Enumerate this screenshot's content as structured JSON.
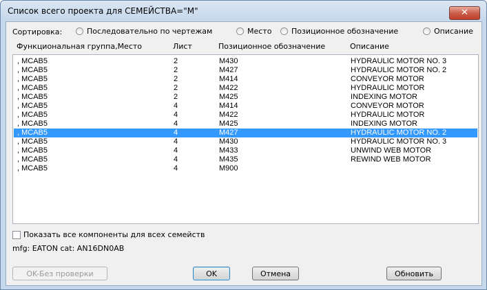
{
  "window": {
    "title": "Список всего проекта для СЕМЕЙСТВА=\"M\"",
    "close_label": "✕"
  },
  "sort": {
    "label": "Сортировка:",
    "options": [
      "Последовательно по чертежам",
      "Место",
      "Позиционное обозначение",
      "Описание"
    ]
  },
  "columns": [
    "Функциональная группа,Место",
    "Лист",
    "Позиционное обозначение",
    "Описание"
  ],
  "rows": [
    {
      "loc": ", MCAB5",
      "sheet": "2",
      "tag": "M430",
      "desc": "HYDRAULIC MOTOR NO. 3"
    },
    {
      "loc": ", MCAB5",
      "sheet": "2",
      "tag": "M427",
      "desc": "HYDRAULIC MOTOR NO. 2"
    },
    {
      "loc": ", MCAB5",
      "sheet": "2",
      "tag": "M414",
      "desc": "CONVEYOR MOTOR"
    },
    {
      "loc": ", MCAB5",
      "sheet": "2",
      "tag": "M422",
      "desc": "HYDRAULIC MOTOR"
    },
    {
      "loc": ", MCAB5",
      "sheet": "2",
      "tag": "M425",
      "desc": "INDEXING MOTOR"
    },
    {
      "loc": ", MCAB5",
      "sheet": "4",
      "tag": "M414",
      "desc": "CONVEYOR MOTOR"
    },
    {
      "loc": ", MCAB5",
      "sheet": "4",
      "tag": "M422",
      "desc": "HYDRAULIC MOTOR"
    },
    {
      "loc": ", MCAB5",
      "sheet": "4",
      "tag": "M425",
      "desc": "INDEXING MOTOR"
    },
    {
      "loc": ", MCAB5",
      "sheet": "4",
      "tag": "M427",
      "desc": "HYDRAULIC MOTOR NO. 2"
    },
    {
      "loc": ", MCAB5",
      "sheet": "4",
      "tag": "M430",
      "desc": "HYDRAULIC MOTOR NO. 3"
    },
    {
      "loc": ", MCAB5",
      "sheet": "4",
      "tag": "M433",
      "desc": "UNWIND WEB MOTOR"
    },
    {
      "loc": ", MCAB5",
      "sheet": "4",
      "tag": "M435",
      "desc": "REWIND WEB MOTOR"
    },
    {
      "loc": ", MCAB5",
      "sheet": "4",
      "tag": "M900",
      "desc": ""
    }
  ],
  "selected_row": 8,
  "show_all_label": "Показать все компоненты для всех семейств",
  "mfg_text": "mfg: EATON  cat: AN16DN0AB",
  "buttons": {
    "ok_noverify": "OK-Без проверки",
    "ok": "OK",
    "cancel": "Отмена",
    "refresh": "Обновить"
  },
  "colors": {
    "selection": "#3399ff",
    "close": "#c85a45"
  }
}
